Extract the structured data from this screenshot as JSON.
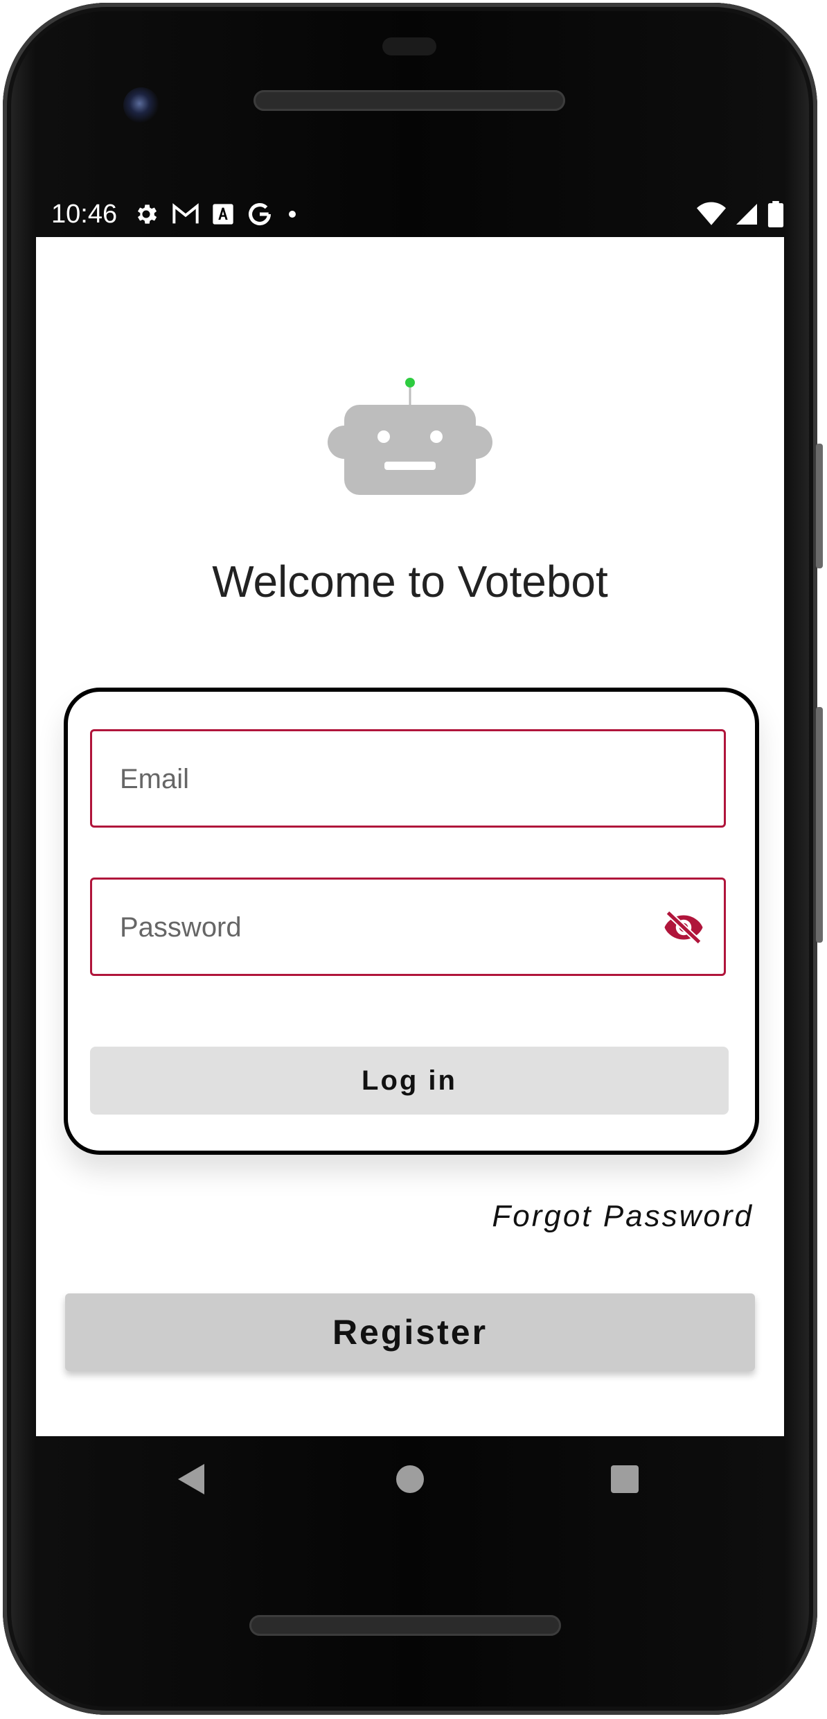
{
  "status_bar": {
    "time": "10:46",
    "left_icons": [
      "gear-icon",
      "gmail-icon",
      "font-icon",
      "google-icon",
      "dot-icon"
    ],
    "right_icons": [
      "wifi-icon",
      "signal-icon",
      "battery-icon"
    ]
  },
  "app": {
    "logo": "robot-icon",
    "welcome_text": "Welcome to Votebot"
  },
  "login_form": {
    "email_placeholder": "Email",
    "email_value": "",
    "password_placeholder": "Password",
    "password_value": "",
    "visibility_toggle": "eye-off-icon",
    "login_label": "Log in"
  },
  "links": {
    "forgot_password": "Forgot Password"
  },
  "register": {
    "label": "Register"
  },
  "nav_bar": {
    "buttons": [
      "back-icon",
      "home-icon",
      "recents-icon"
    ]
  },
  "colors": {
    "accent": "#b0153b",
    "robot": "#bdbdbd",
    "antenna_light": "#2ecc40",
    "login_button_bg": "#e0e0e0",
    "register_button_bg": "#cccccc"
  }
}
